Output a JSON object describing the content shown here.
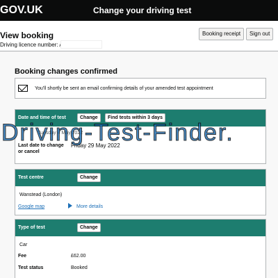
{
  "header": {
    "logo": "GOV.UK",
    "service_name": "Change your driving test"
  },
  "subheader": {
    "title": "View booking",
    "licence_label": "Driving licence number: AVCI",
    "booking_receipt_label": "Booking receipt",
    "sign_out_label": "Sign out"
  },
  "confirmation": {
    "heading": "Booking changes confirmed",
    "notice": "You'll shortly be sent an email confirming details of your amended test appointment"
  },
  "date_card": {
    "title": "Date and time of test",
    "change_label": "Change",
    "find_tests_label": "Find tests within 3 days",
    "appointment_text": "Tuesday 4 May 2022",
    "last_date_label": "Last date to change or cancel",
    "last_date_value": "Friday 29 May 2022"
  },
  "centre_card": {
    "title": "Test centre",
    "change_label": "Change",
    "centre_name": "Wanstead (London)",
    "map_link": "Google map",
    "more_details": "More details"
  },
  "type_card": {
    "title": "Type of test",
    "change_label": "Change",
    "type_value": "Car",
    "fee_label": "Fee",
    "fee_value": "£62.00",
    "status_label": "Test status",
    "status_value": "Booked"
  },
  "watermark": "Driving-Test-Finder.",
  "colors": {
    "header_bg": "#0b0c0c",
    "card_header_bg": "#1d7d6f",
    "link": "#1d70b8"
  }
}
